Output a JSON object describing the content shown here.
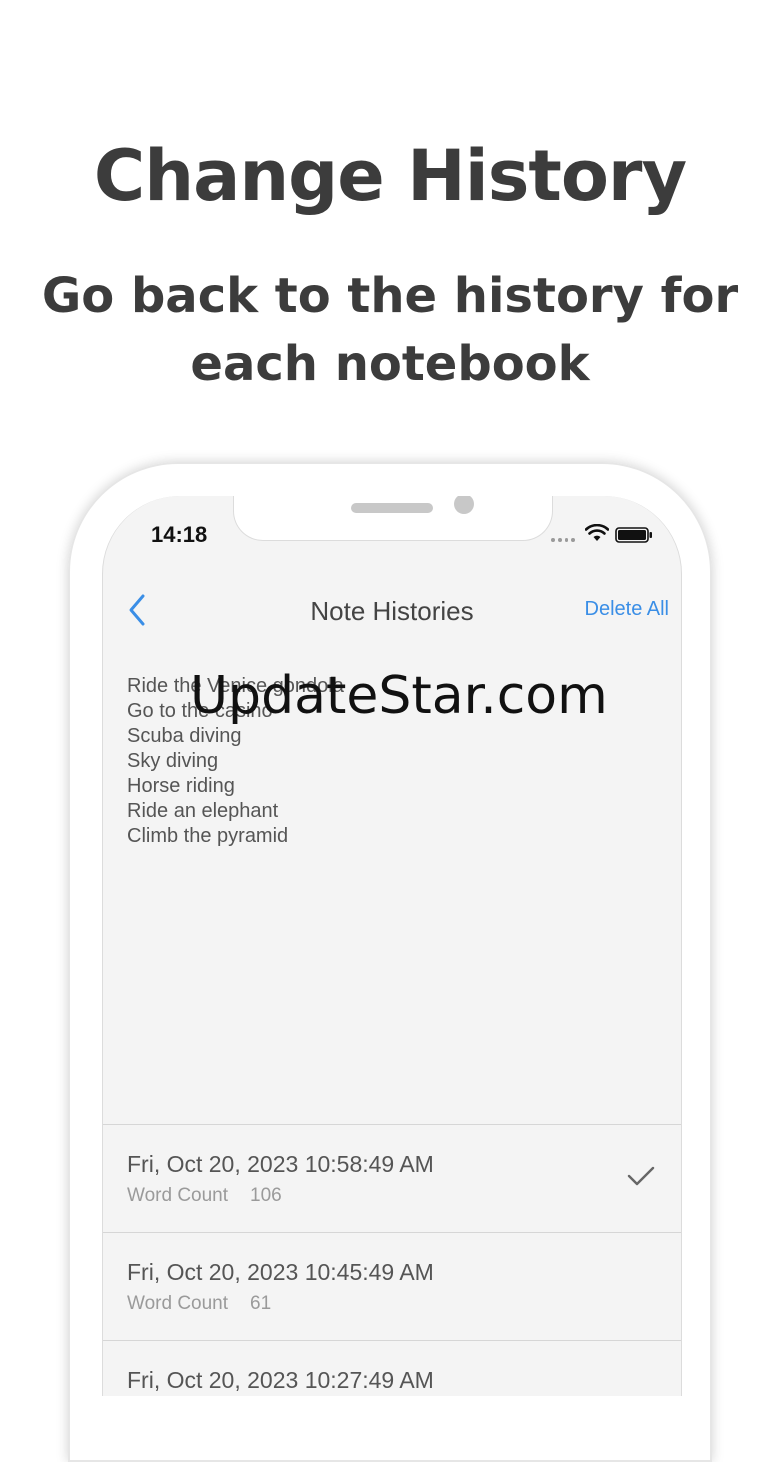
{
  "promo": {
    "title": "Change History",
    "subtitle_line1": "Go back to the history for",
    "subtitle_line2": "each notebook"
  },
  "status_bar": {
    "time": "14:18",
    "icons": [
      "signal-dots-icon",
      "wifi-icon",
      "battery-icon"
    ]
  },
  "nav": {
    "back_icon": "chevron-left-icon",
    "title": "Note Histories",
    "action": "Delete All"
  },
  "note": {
    "lines": [
      "Ride the Venice gondola",
      "Go to the casino",
      "Scuba diving",
      "Sky diving",
      "Horse riding",
      "Ride an elephant",
      "Climb the pyramid"
    ]
  },
  "watermark": "UpdateStar.com",
  "history": [
    {
      "date": "Fri, Oct 20, 2023 10:58:49 AM",
      "word_count_label": "Word Count",
      "word_count": "106",
      "selected": true
    },
    {
      "date": "Fri, Oct 20, 2023 10:45:49 AM",
      "word_count_label": "Word Count",
      "word_count": "61",
      "selected": false
    },
    {
      "date": "Fri, Oct 20, 2023 10:27:49 AM",
      "word_count_label": "",
      "word_count": "",
      "selected": false
    }
  ],
  "colors": {
    "accent": "#3a8ee6",
    "screen_bg": "#f4f4f4",
    "headline": "#3c3c3c"
  }
}
